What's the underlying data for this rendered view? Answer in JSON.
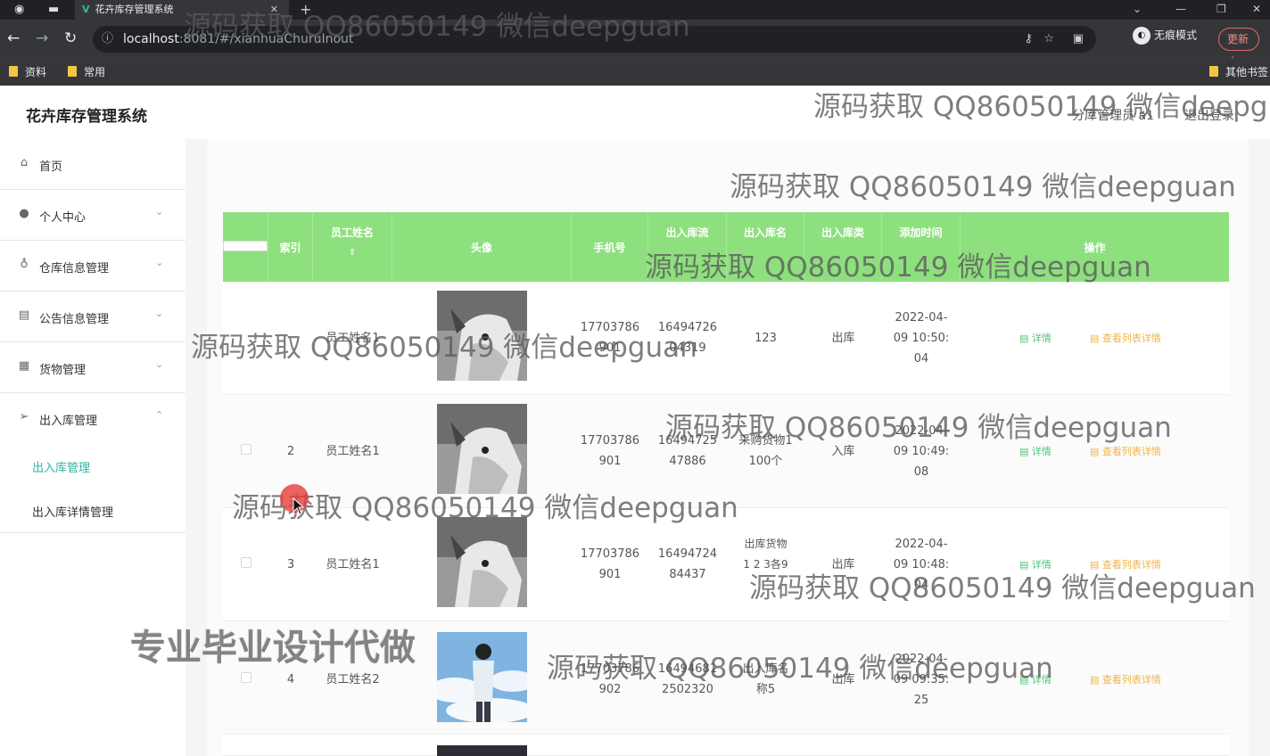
{
  "browser": {
    "tab_title": "花卉库存管理系统",
    "url_host": "localhost",
    "url_path": ":8081/#/xianhuaChuruInout",
    "incognito_label": "无痕模式",
    "update_label": "更新",
    "bookmarks": [
      "资料",
      "常用"
    ],
    "other_bookmarks": "其他书签"
  },
  "header": {
    "title": "花卉库存管理系统",
    "user": "分库管理员 a1",
    "logout": "退出登录"
  },
  "sidebar": {
    "items": [
      {
        "label": "首页",
        "icon": "home-icon"
      },
      {
        "label": "个人中心",
        "icon": "user-icon"
      },
      {
        "label": "仓库信息管理",
        "icon": "mic-icon"
      },
      {
        "label": "公告信息管理",
        "icon": "notice-icon"
      },
      {
        "label": "货物管理",
        "icon": "goods-icon"
      },
      {
        "label": "出入库管理",
        "icon": "send-icon"
      }
    ],
    "sub_items": [
      "出入库管理",
      "出入库详情管理"
    ]
  },
  "table": {
    "headers": [
      "索引",
      "员工姓名",
      "头像",
      "手机号",
      "出入库流",
      "出入库名",
      "出入库类",
      "添加时间",
      "操作"
    ],
    "rows": [
      {
        "index": "1",
        "name": "员工姓名1",
        "phone": [
          "17703786",
          "901"
        ],
        "flow": [
          "16494726",
          "04319"
        ],
        "title": [
          "123"
        ],
        "type": "出库",
        "time": [
          "2022-04-",
          "09 10:50:",
          "04"
        ],
        "avatar": "dog"
      },
      {
        "index": "2",
        "name": "员工姓名1",
        "phone": [
          "17703786",
          "901"
        ],
        "flow": [
          "16494725",
          "47886"
        ],
        "title": [
          "采购货物1",
          "100个"
        ],
        "type": "入库",
        "time": [
          "2022-04-",
          "09 10:49:",
          "08"
        ],
        "avatar": "dog"
      },
      {
        "index": "3",
        "name": "员工姓名1",
        "phone": [
          "17703786",
          "901"
        ],
        "flow": [
          "16494724",
          "84437"
        ],
        "title": [
          "出库货物",
          "1 2 3各9"
        ],
        "type": "出库",
        "time": [
          "2022-04-",
          "09 10:48:",
          "04"
        ],
        "avatar": "dog"
      },
      {
        "index": "4",
        "name": "员工姓名2",
        "phone": [
          "17703786",
          "902"
        ],
        "flow": [
          "16494681",
          "2502320"
        ],
        "title": [
          "出入库名",
          "称5"
        ],
        "type": "出库",
        "time": [
          "2022-04-",
          "09 09:35:",
          "25"
        ],
        "avatar": "sky"
      }
    ],
    "detail_label": "详情",
    "view_label": "查看列表详情"
  },
  "watermark": {
    "text": "源码获取 QQ86050149 微信deepguan",
    "promo": "专业毕业设计代做"
  }
}
